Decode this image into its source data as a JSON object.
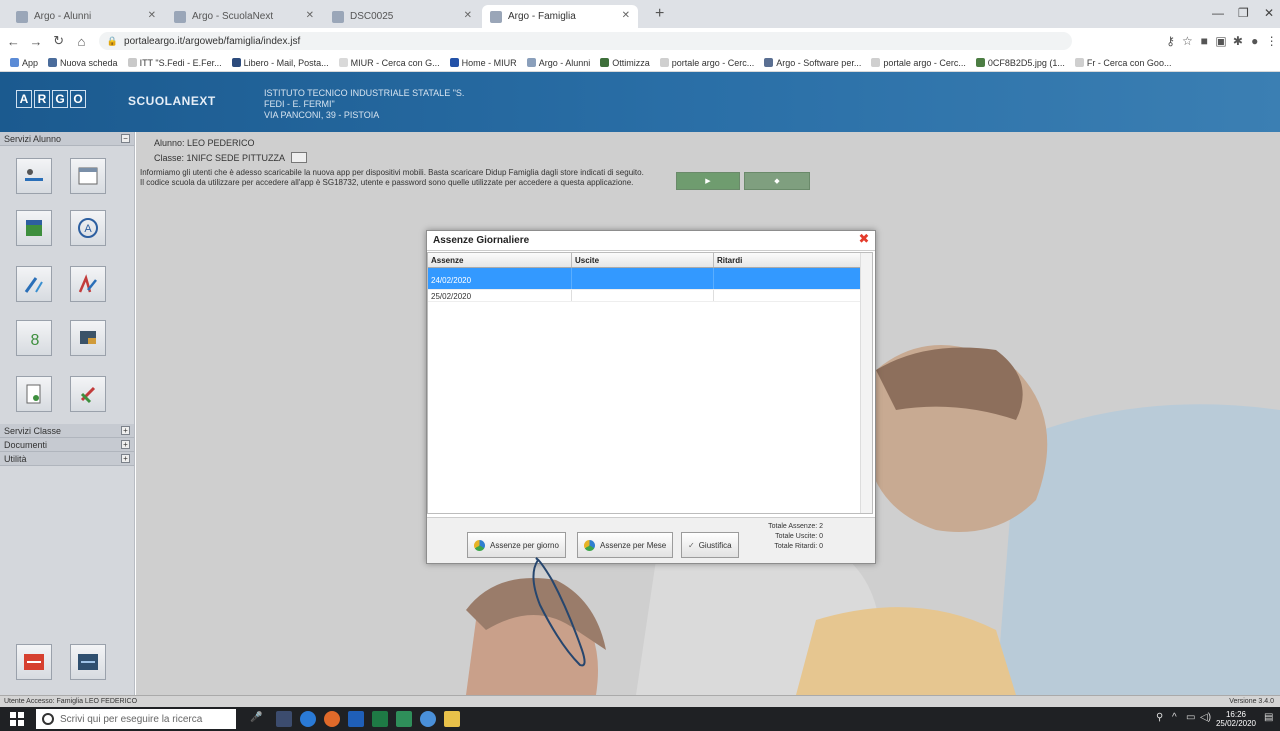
{
  "browser": {
    "tabs": [
      {
        "label": "Argo - Alunni"
      },
      {
        "label": "Argo - ScuolaNext"
      },
      {
        "label": "DSC0025"
      },
      {
        "label": "Argo - Famiglia"
      }
    ],
    "url": "portaleargo.it/argoweb/famiglia/index.jsf",
    "bookmarks": [
      {
        "label": "App"
      },
      {
        "label": "Nuova scheda"
      },
      {
        "label": "ITT \"S.Fedi - E.Fer..."
      },
      {
        "label": "Libero - Mail, Posta..."
      },
      {
        "label": "MIUR - Cerca con G..."
      },
      {
        "label": "Home - MIUR"
      },
      {
        "label": "Argo - Alunni"
      },
      {
        "label": "Ottimizza"
      },
      {
        "label": "portale argo - Cerc..."
      },
      {
        "label": "Argo - Software per..."
      },
      {
        "label": "portale argo - Cerc..."
      },
      {
        "label": "0CF8B2D5.jpg (1..."
      },
      {
        "label": "Fr - Cerca con Goo..."
      }
    ]
  },
  "app": {
    "logo_letters": [
      "A",
      "R",
      "G",
      "O"
    ],
    "brand": "SCUOLANEXT",
    "school_lines": [
      "ISTITUTO TECNICO INDUSTRIALE STATALE \"S.",
      "FEDI - E. FERMI\"",
      "VIA PANCONI, 39 - PISTOIA"
    ]
  },
  "sidebar": {
    "sections": {
      "servizi_alunno": "Servizi Alunno",
      "servizi_classe": "Servizi Classe",
      "documenti": "Documenti",
      "utilita": "Utilità"
    }
  },
  "main": {
    "student_line": "Alunno: LEO PEDERICO",
    "class_line": "Classe: 1NIFC SEDE PITTUZZA",
    "info_text_1": "Informiamo gli utenti che è adesso scaricabile la nuova app per dispositivi mobili. Basta scaricare Didup Famiglia dagli store indicati di seguito.",
    "info_text_2": "Il codice scuola da utilizzare per accedere all'app è SG18732, utente e password sono quelle utilizzate per accedere a questa applicazione."
  },
  "modal": {
    "title": "Assenze Giornaliere",
    "columns": [
      "Assenze",
      "Uscite",
      "Ritardi"
    ],
    "rows": [
      {
        "assenze": "24/02/2020",
        "uscite": "",
        "ritardi": ""
      },
      {
        "assenze": "25/02/2020",
        "uscite": "",
        "ritardi": ""
      }
    ],
    "buttons": {
      "per_giorno": "Assenze per giorno",
      "per_mese": "Assenze per Mese",
      "giustifica": "Giustifica"
    },
    "totals": {
      "assenze": "Totale Assenze: 2",
      "uscite": "Totale Uscite: 0",
      "ritardi": "Totale Ritardi: 0"
    }
  },
  "statusbar": {
    "left": "Utente Accesso: Famiglia LEO FEDERICO",
    "right": "Versione 3.4.0"
  },
  "taskbar": {
    "search_placeholder": "Scrivi qui per eseguire la ricerca",
    "time": "16:26",
    "date": "25/02/2020"
  }
}
